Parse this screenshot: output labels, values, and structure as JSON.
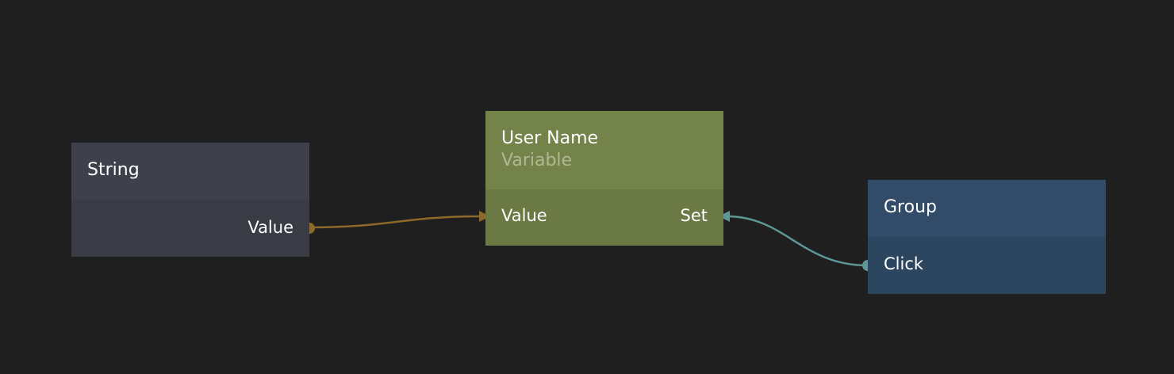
{
  "colors": {
    "canvas_background": "#1f1f1f",
    "string_header": "#3e414b",
    "string_body": "#393b45",
    "variable_header": "#74834a",
    "variable_body": "#6b7944",
    "variable_subtitle": "#b0b994",
    "group_header": "#324b68",
    "group_body": "#2d465f",
    "value_wire": "#8d6a2a",
    "signal_wire": "#5e9896"
  },
  "nodes": {
    "string": {
      "title": "String",
      "output_port": "Value"
    },
    "variable": {
      "title": "User Name",
      "subtitle": "Variable",
      "input_value_port": "Value",
      "input_set_port": "Set"
    },
    "group": {
      "title": "Group",
      "output_port": "Click"
    }
  },
  "connections": [
    {
      "from": "String.Value",
      "to": "User Name.Value",
      "kind": "value"
    },
    {
      "from": "Group.Click",
      "to": "User Name.Set",
      "kind": "signal"
    }
  ]
}
